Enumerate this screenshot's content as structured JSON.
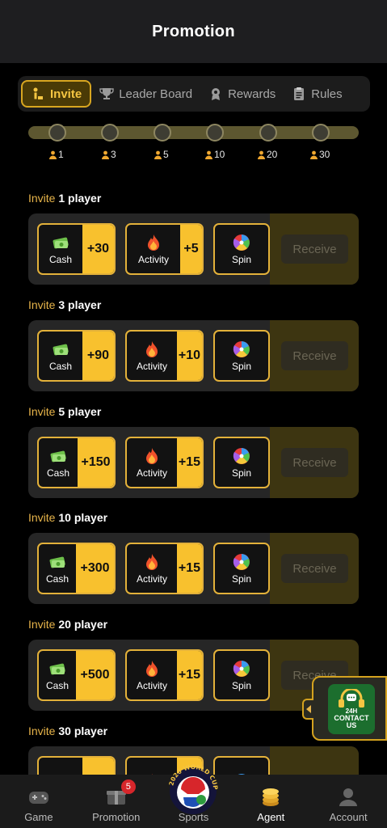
{
  "header": {
    "title": "Promotion"
  },
  "tabs": [
    {
      "label": "Invite",
      "active": true,
      "icon": "invite-icon"
    },
    {
      "label": "Leader Board",
      "active": false,
      "icon": "trophy-icon"
    },
    {
      "label": "Rewards",
      "active": false,
      "icon": "rewards-icon"
    },
    {
      "label": "Rules",
      "active": false,
      "icon": "rules-icon"
    }
  ],
  "milestones": [
    "1",
    "3",
    "5",
    "10",
    "20",
    "30"
  ],
  "sections": [
    {
      "prefix": "Invite",
      "count": "1",
      "suffix": "player",
      "cash_label": "Cash",
      "cash": "+30",
      "activity_label": "Activity",
      "activity": "+5",
      "spin_label": "Spin",
      "receive": "Receive"
    },
    {
      "prefix": "Invite",
      "count": "3",
      "suffix": "player",
      "cash_label": "Cash",
      "cash": "+90",
      "activity_label": "Activity",
      "activity": "+10",
      "spin_label": "Spin",
      "receive": "Receive"
    },
    {
      "prefix": "Invite",
      "count": "5",
      "suffix": "player",
      "cash_label": "Cash",
      "cash": "+150",
      "activity_label": "Activity",
      "activity": "+15",
      "spin_label": "Spin",
      "receive": "Receive"
    },
    {
      "prefix": "Invite",
      "count": "10",
      "suffix": "player",
      "cash_label": "Cash",
      "cash": "+300",
      "activity_label": "Activity",
      "activity": "+15",
      "spin_label": "Spin",
      "receive": "Receive"
    },
    {
      "prefix": "Invite",
      "count": "20",
      "suffix": "player",
      "cash_label": "Cash",
      "cash": "+500",
      "activity_label": "Activity",
      "activity": "+15",
      "spin_label": "Spin",
      "receive": "Receive"
    },
    {
      "prefix": "Invite",
      "count": "30",
      "suffix": "player"
    }
  ],
  "contact": {
    "line1": "24H",
    "line2": "CONTACT",
    "line3": "US"
  },
  "sports_logo_text": "2026 WORLD CUP",
  "nav": [
    {
      "label": "Game",
      "icon": "gamepad-icon"
    },
    {
      "label": "Promotion",
      "icon": "promotion-icon",
      "badge": "5"
    },
    {
      "label": "Sports",
      "icon": "world-cup-logo"
    },
    {
      "label": "Agent",
      "icon": "agent-coins-icon",
      "active": true
    },
    {
      "label": "Account",
      "icon": "account-icon"
    }
  ],
  "colors": {
    "accent": "#f8c12e",
    "gold_text": "#e7b44a",
    "card_bg": "#262626",
    "header_bg": "#1e1e20"
  }
}
